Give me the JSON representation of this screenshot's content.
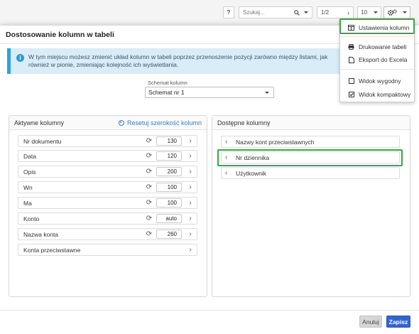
{
  "toolbar": {
    "help_label": "?",
    "search_placeholder": "Szukaj...",
    "search_icon": "search-icon",
    "page_indicator": "1/2",
    "per_page": "10",
    "settings_icon": "gears-icon"
  },
  "modal": {
    "title": "Dostosowanie kolumn w tabeli",
    "info_text": "W tym miejscu możesz zmienić układ kolumn w tabeli poprzez przenoszenie pozycji zarówno między listami, jak również w pionie, zmieniając kolejność ich wyświetlania.",
    "schema_label": "Schemat kolumn",
    "schema_value": "Schemat nr 1",
    "active_title": "Aktywne kolumny",
    "reset_label": "Resetuj szerokość kolumn",
    "available_title": "Dostępne kolumny",
    "active_columns": [
      {
        "name": "Nr dokumentu",
        "width": "130",
        "resettable": true
      },
      {
        "name": "Data",
        "width": "120",
        "resettable": true
      },
      {
        "name": "Opis",
        "width": "200",
        "resettable": true
      },
      {
        "name": "Wn",
        "width": "100",
        "resettable": true
      },
      {
        "name": "Ma",
        "width": "100",
        "resettable": true
      },
      {
        "name": "Konto",
        "width": "auto",
        "resettable": true
      },
      {
        "name": "Nazwa konta",
        "width": "260",
        "resettable": true
      },
      {
        "name": "Konta przeciwstawne",
        "width": "",
        "resettable": false
      }
    ],
    "available_columns": [
      {
        "name": "Nazwy kont przeciwstawnych"
      },
      {
        "name": "Nr dziennika"
      },
      {
        "name": "Użytkownik"
      }
    ],
    "cancel_label": "Anuluj",
    "save_label": "Zapisz"
  },
  "menu": {
    "items": [
      {
        "label": "Ustawienia kolumn",
        "icon": "columns-icon"
      },
      {
        "label": "Drukowanie tabeli",
        "icon": "print-icon"
      },
      {
        "label": "Eksport do Excela",
        "icon": "file-icon"
      },
      {
        "label": "Widok wygodny",
        "icon": "checkbox-unchecked-icon"
      },
      {
        "label": "Widok kompaktowy",
        "icon": "checkbox-checked-icon"
      }
    ]
  },
  "colors": {
    "primary": "#3366c8",
    "link": "#3a7cc2",
    "info_bg": "#d9ecf7",
    "info_accent": "#29a3e0",
    "highlight": "#3aa44a"
  }
}
